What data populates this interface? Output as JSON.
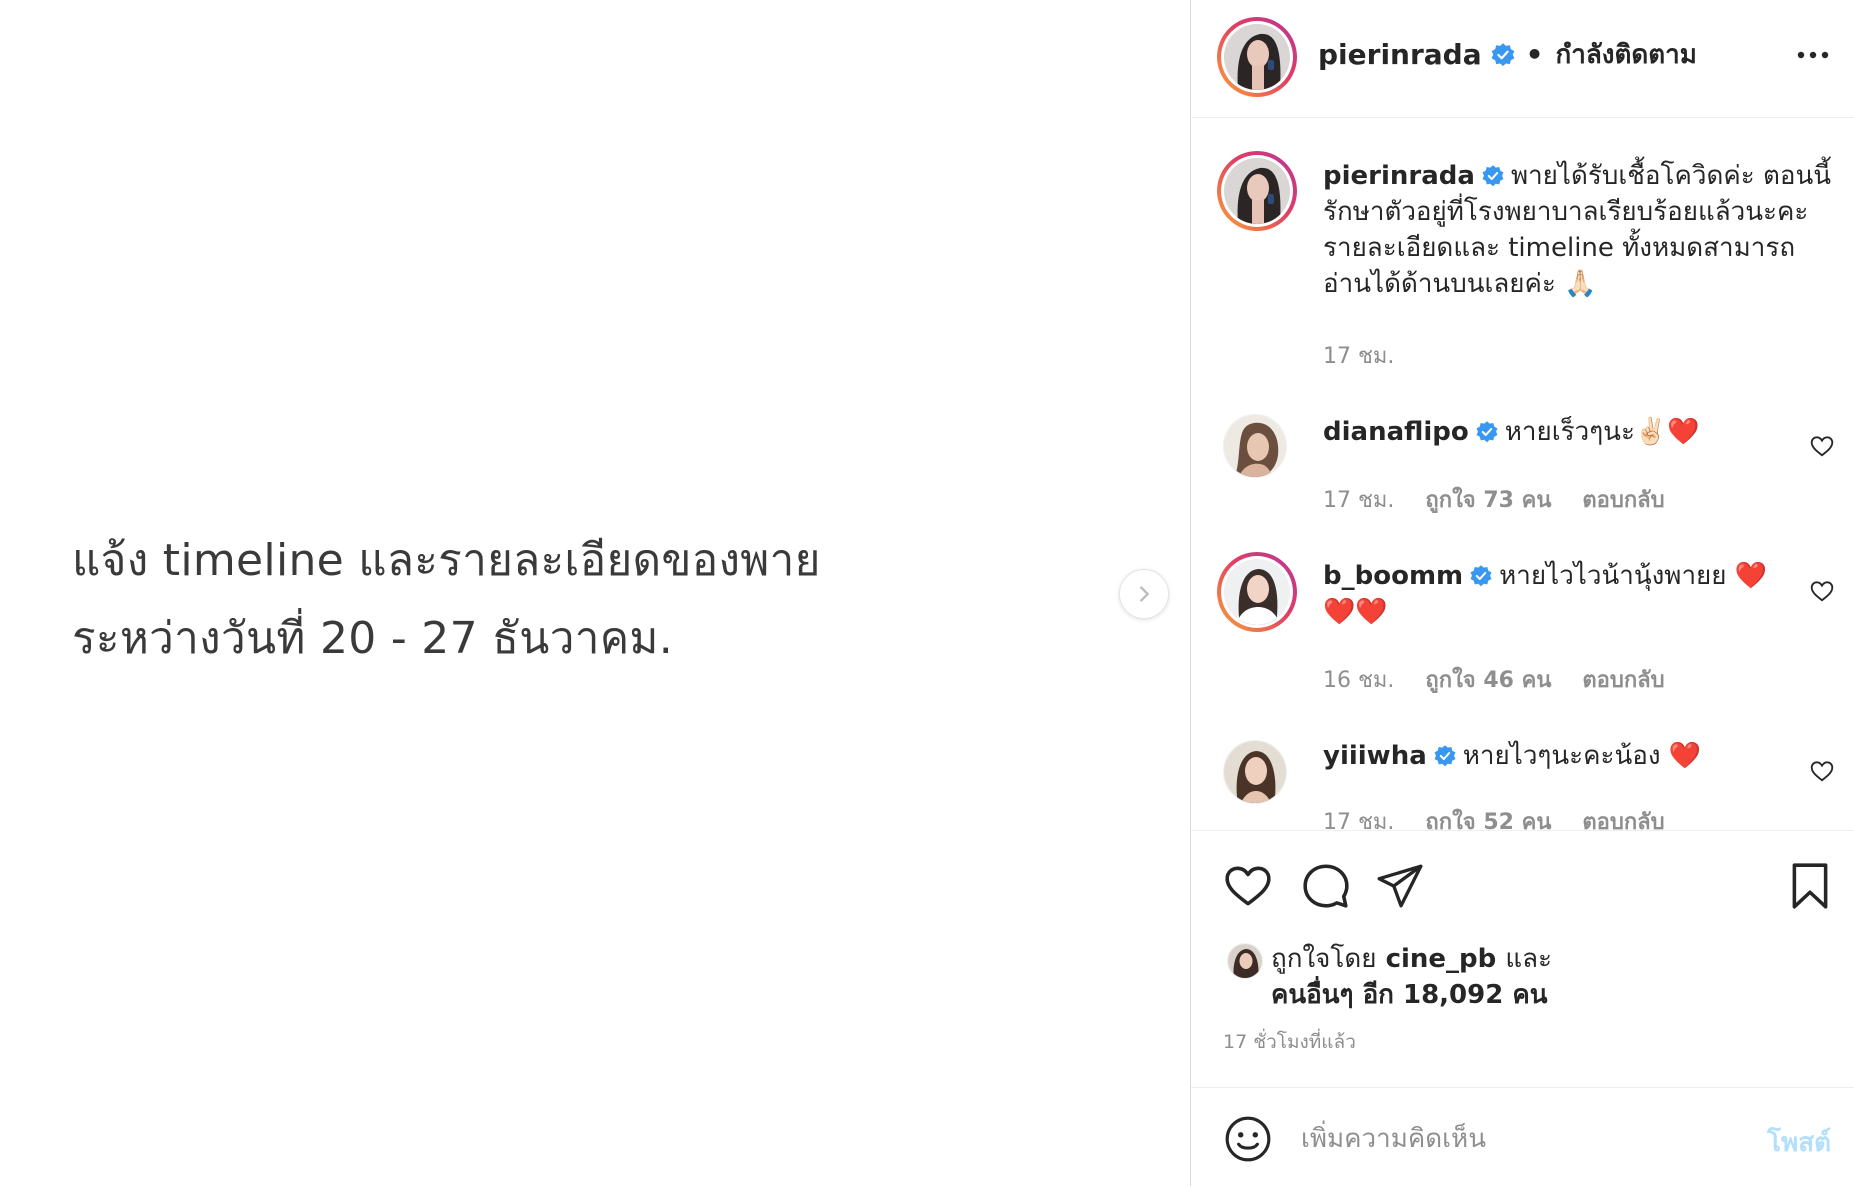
{
  "media": {
    "line1": "แจ้ง timeline และรายละเอียดของพาย",
    "line2": "ระหว่างวันที่ 20 - 27 ธันวาคม."
  },
  "header": {
    "username": "pierinrada",
    "separator": "•",
    "following": "กำลังติดตาม"
  },
  "caption": {
    "username": "pierinrada",
    "text": "พายได้รับเชื้อโควิดค่ะ ตอนนี้รักษาตัวอยู่ที่โรงพยาบาลเรียบร้อยแล้วนะคะ รายละเอียดและ timeline ทั้งหมดสามารถอ่านได้ด้านบนเลยค่ะ 🙏🏻",
    "time": "17 ชม."
  },
  "comments": [
    {
      "username": "dianaflipo",
      "text": "หายเร็วๆนะ✌🏻❤️",
      "time": "17 ชม.",
      "likes": "ถูกใจ 73 คน",
      "reply": "ตอบกลับ"
    },
    {
      "username": "b_boomm",
      "text": "หายไวไวน้านุ้งพายย ❤️❤️❤️",
      "time": "16 ชม.",
      "likes": "ถูกใจ 46 คน",
      "reply": "ตอบกลับ"
    },
    {
      "username": "yiiiwha",
      "text": "หายไวๆนะคะน้อง ❤️",
      "time": "17 ชม.",
      "likes": "ถูกใจ 52 คน",
      "reply": "ตอบกลับ"
    }
  ],
  "likes": {
    "prefix": "ถูกใจโดย",
    "user": "cine_pb",
    "and": "และ",
    "others": "คนอื่นๆ อีก 18,092 คน"
  },
  "time_ago": "17 ชั่วโมงที่แล้ว",
  "comment_box": {
    "placeholder": "เพิ่มความคิดเห็น",
    "post": "โพสต์"
  },
  "icons": {
    "next": "chevron-right-icon",
    "more": "more-horizontal-icon",
    "like": "heart-icon",
    "comment": "comment-icon",
    "share": "paper-plane-icon",
    "save": "bookmark-icon",
    "emoji": "emoji-icon"
  },
  "colors": {
    "verified": "#3897f0",
    "text": "#262626",
    "muted": "#8e8e8e",
    "post_disabled": "#b2dffc"
  }
}
